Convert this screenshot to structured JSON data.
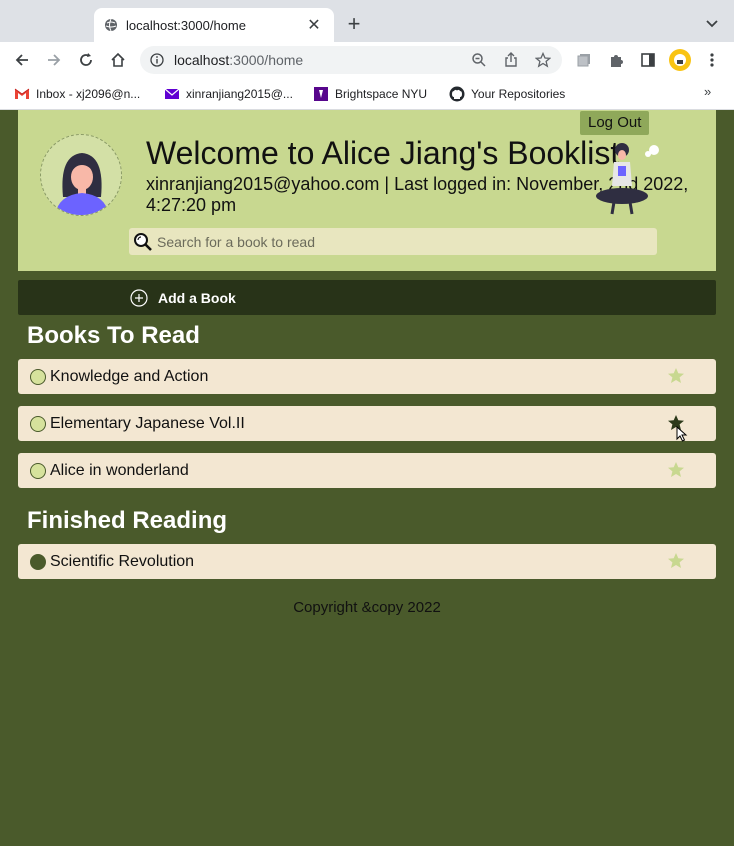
{
  "browser": {
    "tab_title": "localhost:3000/home",
    "url_host": "localhost",
    "url_path": ":3000/home",
    "bookmarks": [
      {
        "label": "Inbox - xj2096@n...",
        "icon": "gmail-icon"
      },
      {
        "label": "xinranjiang2015@...",
        "icon": "mail-icon"
      },
      {
        "label": "Brightspace NYU",
        "icon": "brightspace-icon"
      },
      {
        "label": "Your Repositories",
        "icon": "github-icon"
      }
    ],
    "bookmarks_overflow": "»"
  },
  "header": {
    "welcome": "Welcome to Alice Jiang's Booklist",
    "user_info": "xinranjiang2015@yahoo.com | Last logged in: November, 2nd 2022, 4:27:20 pm",
    "logout_label": "Log Out",
    "search_placeholder": "Search for a book to read"
  },
  "add_book_label": "Add a Book",
  "sections": {
    "to_read_title": "Books To Read",
    "finished_title": "Finished Reading"
  },
  "books_to_read": [
    {
      "title": "Knowledge and Action",
      "finished": false,
      "star_active": false
    },
    {
      "title": "Elementary Japanese Vol.II",
      "finished": false,
      "star_active": true
    },
    {
      "title": "Alice in wonderland",
      "finished": false,
      "star_active": false
    }
  ],
  "books_finished": [
    {
      "title": "Scientific Revolution",
      "finished": true,
      "star_active": false
    }
  ],
  "footer": "Copyright &copy 2022",
  "colors": {
    "page_bg": "#4a5a2b",
    "header_bg": "#c8d890",
    "book_bg": "#f3e7d2",
    "star_inactive": "#c8d890",
    "star_active": "#2c3a1a"
  }
}
